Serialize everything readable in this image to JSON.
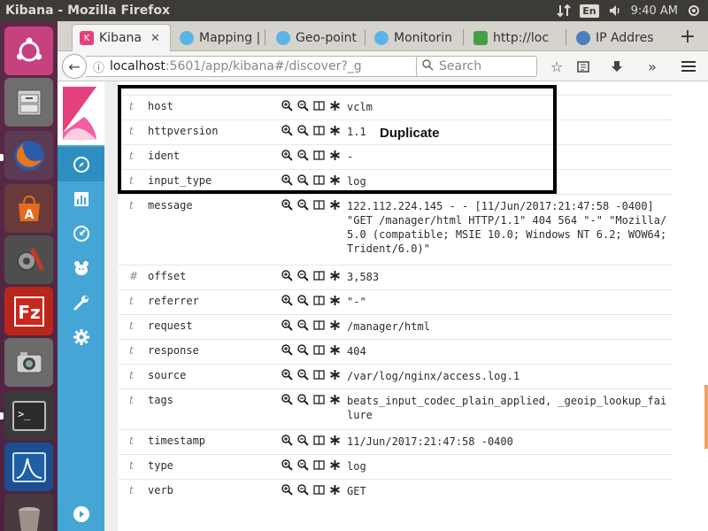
{
  "window": {
    "title": "Kibana - Mozilla Firefox"
  },
  "system": {
    "keyboard_layout": "En",
    "time": "9:40 AM",
    "icons": [
      "network-transfer-icon",
      "volume-icon",
      "power-gear-icon"
    ]
  },
  "launcher": {
    "items": [
      {
        "name": "ubuntu-dash-icon",
        "color": "#c6427e"
      },
      {
        "name": "file-cabinet-icon",
        "color": "#7a7a7a"
      },
      {
        "name": "firefox-icon",
        "color": "#e8751a"
      },
      {
        "name": "software-center-icon",
        "color": "#e56b1f"
      },
      {
        "name": "system-settings-icon",
        "color": "#8a8a8a"
      },
      {
        "name": "filezilla-icon",
        "color": "#c8281d"
      },
      {
        "name": "camera-icon",
        "color": "#9a9a9a"
      },
      {
        "name": "terminal-icon",
        "color": "#2e2e2e"
      },
      {
        "name": "wireshark-icon",
        "color": "#1e5fa8"
      },
      {
        "name": "trash-icon",
        "color": "#8c7f77"
      }
    ]
  },
  "tabs": [
    {
      "label": "Kibana",
      "favicon": "kibana-icon",
      "color": "#e5407e",
      "active": true
    },
    {
      "label": "Mapping |",
      "favicon": "elastic-icon",
      "color": "#5ab4e6"
    },
    {
      "label": "Geo-point",
      "favicon": "elastic-icon",
      "color": "#5ab4e6"
    },
    {
      "label": "Monitorin",
      "favicon": "elastic-icon",
      "color": "#5ab4e6"
    },
    {
      "label": "http://loc",
      "favicon": "layers-icon",
      "color": "#44a047"
    },
    {
      "label": "IP Addres",
      "favicon": "globe-icon",
      "color": "#4a7fc0"
    }
  ],
  "navbar": {
    "url_host": "localhost",
    "url_path": ":5601/app/kibana#/discover?_g",
    "search_placeholder": "Search"
  },
  "kibana_nav": [
    {
      "name": "discover-icon",
      "glyph": "compass",
      "active": true
    },
    {
      "name": "visualize-icon",
      "glyph": "bar-chart"
    },
    {
      "name": "dashboard-icon",
      "glyph": "gauge"
    },
    {
      "name": "timelion-icon",
      "glyph": "bear"
    },
    {
      "name": "dev-tools-icon",
      "glyph": "wrench"
    },
    {
      "name": "management-icon",
      "glyph": "gear"
    }
  ],
  "document": {
    "annotation_label": "Duplicate",
    "fields": [
      {
        "type": "t",
        "name": "host",
        "value": "vclm"
      },
      {
        "type": "t",
        "name": "httpversion",
        "value": "1.1"
      },
      {
        "type": "t",
        "name": "ident",
        "value": "-"
      },
      {
        "type": "t",
        "name": "input_type",
        "value": "log"
      },
      {
        "type": "t",
        "name": "message",
        "value": "122.112.224.145 - - [11/Jun/2017:21:47:58 -0400] \"GET /manager/html HTTP/1.1\" 404 564 \"-\" \"Mozilla/5.0 (compatible; MSIE 10.0; Windows NT 6.2; WOW64; Trident/6.0)\""
      },
      {
        "type": "#",
        "name": "offset",
        "value": "3,583"
      },
      {
        "type": "t",
        "name": "referrer",
        "value": "\"-\""
      },
      {
        "type": "t",
        "name": "request",
        "value": "/manager/html"
      },
      {
        "type": "t",
        "name": "response",
        "value": "404"
      },
      {
        "type": "t",
        "name": "source",
        "value": "/var/log/nginx/access.log.1"
      },
      {
        "type": "t",
        "name": "tags",
        "value": "beats_input_codec_plain_applied, _geoip_lookup_failure"
      },
      {
        "type": "t",
        "name": "timestamp",
        "value": "11/Jun/2017:21:47:58 -0400"
      },
      {
        "type": "t",
        "name": "type",
        "value": "log"
      },
      {
        "type": "t",
        "name": "verb",
        "value": "GET"
      }
    ]
  }
}
